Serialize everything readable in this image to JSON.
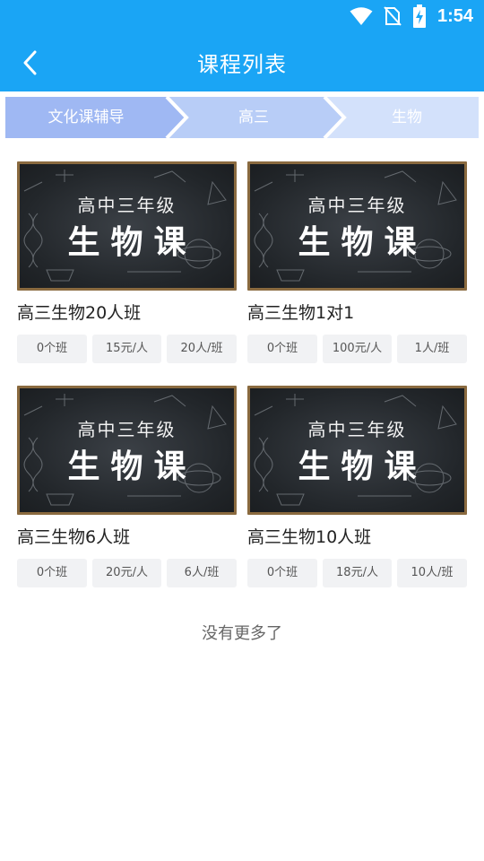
{
  "status_bar": {
    "time": "1:54",
    "icons": [
      "wifi-icon",
      "no-sim-icon",
      "battery-charging-icon"
    ]
  },
  "header": {
    "title": "课程列表",
    "back_icon": "chevron-left-icon"
  },
  "breadcrumb": [
    {
      "label": "文化课辅导"
    },
    {
      "label": "高三"
    },
    {
      "label": "生物"
    }
  ],
  "thumbnail": {
    "line1": "高中三年级",
    "line2": "生物课"
  },
  "courses": [
    {
      "title": "高三生物20人班",
      "tags": [
        "0个班",
        "15元/人",
        "20人/班"
      ]
    },
    {
      "title": "高三生物1对1",
      "tags": [
        "0个班",
        "100元/人",
        "1人/班"
      ]
    },
    {
      "title": "高三生物6人班",
      "tags": [
        "0个班",
        "20元/人",
        "6人/班"
      ]
    },
    {
      "title": "高三生物10人班",
      "tags": [
        "0个班",
        "18元/人",
        "10人/班"
      ]
    }
  ],
  "footer": {
    "no_more": "没有更多了"
  },
  "colors": {
    "appbar": "#1aa5f5",
    "crumb_active": "#9fb8f3",
    "crumb_mid": "#b8cdf7",
    "crumb_last": "#d3e1fb"
  }
}
